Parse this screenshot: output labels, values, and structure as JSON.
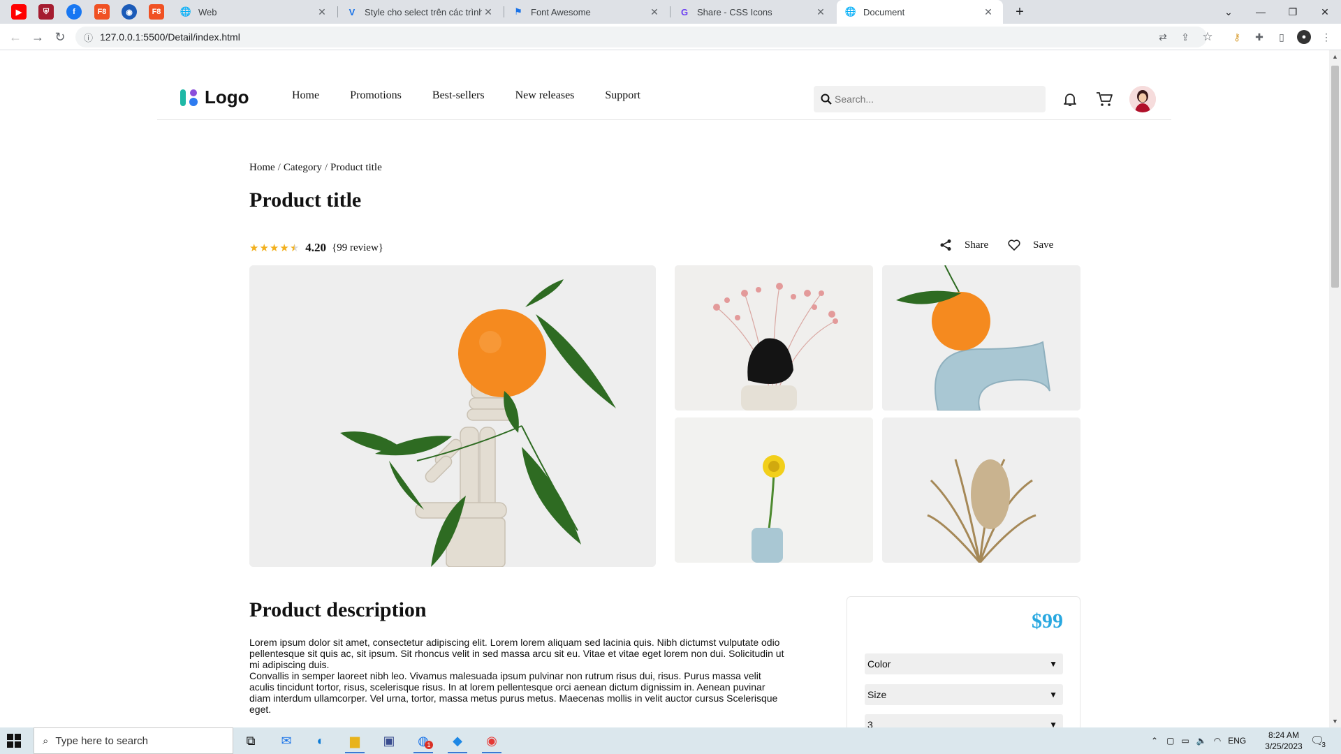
{
  "browser": {
    "pinned_tabs": [
      {
        "name": "youtube",
        "color": "#ff0000",
        "glyph": "▶"
      },
      {
        "name": "harvard",
        "color": "#a51c30",
        "glyph": "⛨"
      },
      {
        "name": "facebook",
        "color": "#1877f2",
        "glyph": "f"
      },
      {
        "name": "f8-1",
        "color": "#f05123",
        "glyph": "F8"
      },
      {
        "name": "edge-profile",
        "color": "#1b5bb8",
        "glyph": "◉"
      },
      {
        "name": "f8-2",
        "color": "#f05123",
        "glyph": "F8"
      }
    ],
    "tabs": [
      {
        "title": "Web",
        "icon": "globe-icon"
      },
      {
        "title": "Style cho select trên các trình du",
        "icon": "v-icon"
      },
      {
        "title": "Font Awesome",
        "icon": "flag-icon"
      },
      {
        "title": "Share - CSS Icons",
        "icon": "css-icons-icon"
      },
      {
        "title": "Document",
        "icon": "globe-icon"
      }
    ],
    "url": "127.0.0.1:5500/Detail/index.html"
  },
  "site": {
    "logo_text": "Logo",
    "nav": [
      "Home",
      "Promotions",
      "Best-sellers",
      "New releases",
      "Support"
    ],
    "search_placeholder": "Search..."
  },
  "product": {
    "breadcrumb": [
      "Home",
      "Category",
      "Product title"
    ],
    "title": "Product title",
    "rating_value": "4.20",
    "rating_stars": 4.2,
    "review_text": "{99 review}",
    "share_label": "Share",
    "save_label": "Save",
    "description_title": "Product description",
    "description_p1": "Lorem ipsum dolor sit amet, consectetur adipiscing elit. Lorem lorem aliquam sed lacinia quis. Nibh dictumst vulputate odio pellentesque sit quis ac, sit ipsum. Sit rhoncus velit in sed massa arcu sit eu. Vitae et vitae eget lorem non dui. Solicitudin ut mi adipiscing duis.",
    "description_p2": "Convallis in semper laoreet nibh leo. Vivamus malesuada ipsum pulvinar non rutrum risus dui, risus. Purus massa velit aculis tincidunt tortor, risus, scelerisque risus. In at lorem pellentesque orci aenean dictum dignissim in. Aenean puvinar diam interdum ullamcorper. Vel urna, tortor, massa metus purus metus. Maecenas mollis in velit auctor cursus Scelerisque eget.",
    "price": "$99",
    "price_color": "#29a8e0",
    "selects": {
      "color": "Color",
      "size": "Size",
      "quantity": "3"
    }
  },
  "taskbar": {
    "search_placeholder": "Type here to search",
    "language": "ENG",
    "time": "8:24 AM",
    "date": "3/25/2023",
    "notification_count": "3",
    "mail_badge": "1"
  }
}
